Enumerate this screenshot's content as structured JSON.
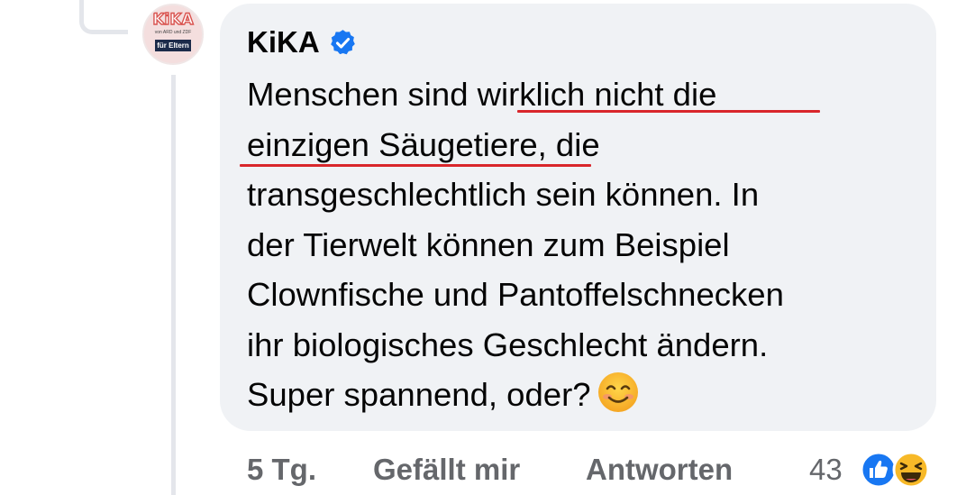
{
  "comment": {
    "author": "KiKA",
    "avatar": {
      "logo": "KiKA",
      "subtitle": "von ARD und ZDF",
      "badge": "für Eltern"
    },
    "verified_icon": "verified-badge-icon",
    "text_lines": [
      "Menschen sind wirklich nicht die",
      "einzigen Säugetiere, die",
      "transgeschlechtlich sein können. In",
      "der Tierwelt können zum Beispiel",
      "Clownfische und Pantoffelschnecken",
      "ihr biologisches Geschlecht ändern.",
      "Super spannend, oder?"
    ],
    "emoji": "smiling-face-emoji",
    "highlight_color": "#d9262b"
  },
  "actions": {
    "time": "5 Tg.",
    "like_label": "Gefällt mir",
    "reply_label": "Antworten",
    "reaction_count": "43",
    "reaction_icons": [
      "like-reaction-icon",
      "haha-reaction-icon"
    ]
  },
  "colors": {
    "bubble": "#f0f2f5",
    "text": "#050505",
    "secondary_text": "#65676b",
    "verified": "#1877f2",
    "thread_line": "#e4e6eb"
  }
}
